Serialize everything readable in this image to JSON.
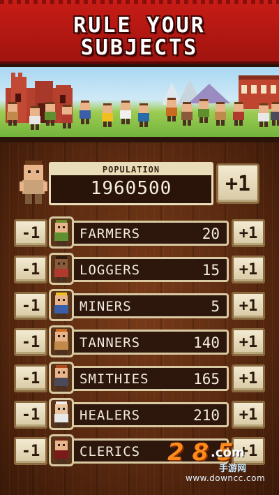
{
  "banner": {
    "title_line1": "RULE YOUR",
    "title_line2": "SUBJECTS",
    "color": "#c81c16"
  },
  "population": {
    "label": "POPULATION",
    "value": "1960500",
    "plus_label": "+1",
    "avatar_icon": "villager-avatar-icon"
  },
  "jobs": [
    {
      "name": "FARMERS",
      "count": "20",
      "minus": "-1",
      "plus": "+1",
      "icon": "farmer-avatar-icon"
    },
    {
      "name": "LOGGERS",
      "count": "15",
      "minus": "-1",
      "plus": "+1",
      "icon": "logger-avatar-icon"
    },
    {
      "name": "MINERS",
      "count": "5",
      "minus": "-1",
      "plus": "+1",
      "icon": "miner-avatar-icon"
    },
    {
      "name": "TANNERS",
      "count": "140",
      "minus": "-1",
      "plus": "+1",
      "icon": "tanner-avatar-icon"
    },
    {
      "name": "SMITHIES",
      "count": "165",
      "minus": "-1",
      "plus": "+1",
      "icon": "smithy-avatar-icon"
    },
    {
      "name": "HEALERS",
      "count": "210",
      "minus": "-1",
      "plus": "+1",
      "icon": "healer-avatar-icon"
    },
    {
      "name": "CLERICS",
      "count": "",
      "minus": "-1",
      "plus": "+1",
      "icon": "cleric-avatar-icon"
    }
  ],
  "watermark": {
    "brand": "2 8 5",
    "com": ".com",
    "cn": "手游网",
    "url": "www.downcc.com"
  }
}
